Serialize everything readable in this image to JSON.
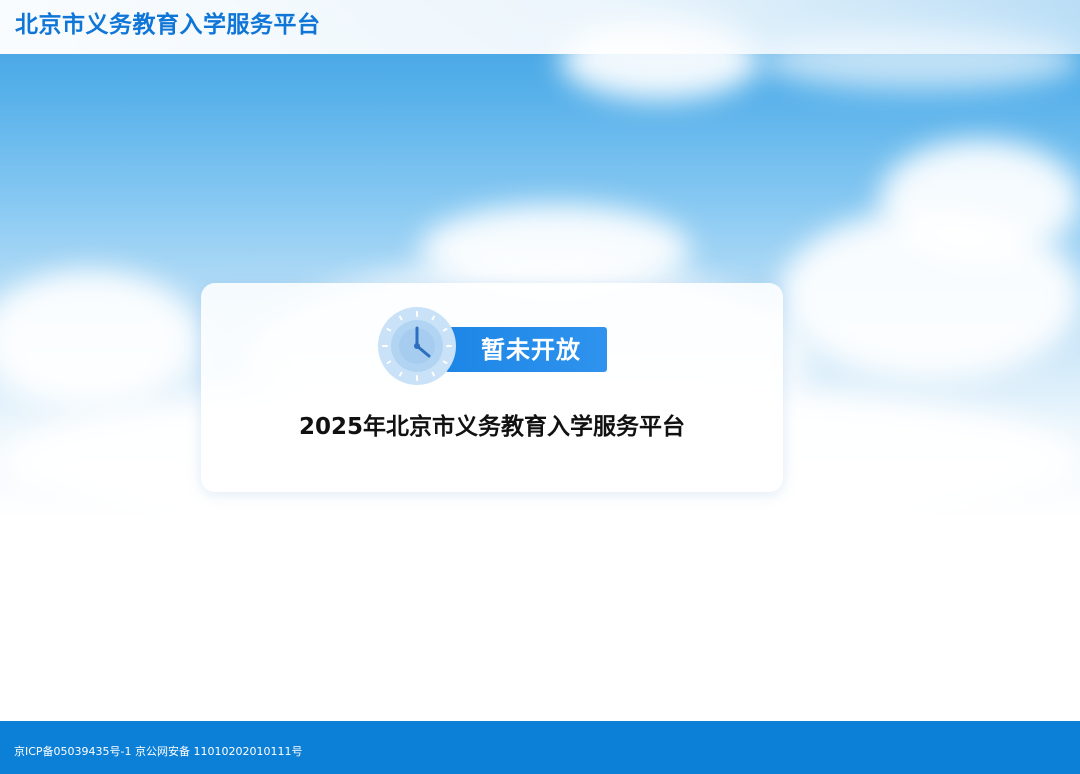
{
  "header": {
    "site_title": "北京市义务教育入学服务平台"
  },
  "notice": {
    "status_label": "暂未开放",
    "title": "2025年北京市义务教育入学服务平台",
    "icon": "clock-icon"
  },
  "footer": {
    "icp_record": "京ICP备05039435号-1",
    "police_record": "京公网安备 11010202010111号"
  },
  "colors": {
    "brand_blue": "#0f76d8",
    "badge_blue": "#1d86e6",
    "footer_blue": "#0c7fd6"
  }
}
